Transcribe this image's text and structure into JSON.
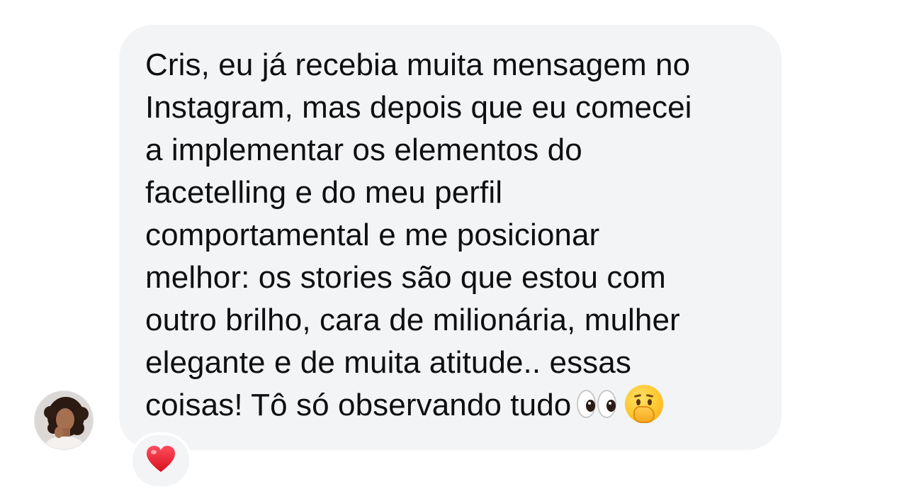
{
  "message": {
    "lines": [
      "Cris, eu já recebia muita mensagem no",
      "Instagram, mas depois que eu comecei",
      "a implementar os elementos do",
      "facetelling e do meu perfil",
      "comportamental e me posicionar",
      "melhor: os stories são que estou com",
      "outro brilho, cara de milionária, mulher",
      "elegante e de muita atitude.. essas",
      "coisas! Tô só observando tudo"
    ],
    "trailing_emojis": [
      "eyes-emoji",
      "face-with-hand-over-mouth-emoji"
    ]
  },
  "sender": {
    "avatar_icon": "profile-photo"
  },
  "reaction": {
    "icon": "red-heart-icon",
    "color": "#e3162b"
  },
  "colors": {
    "bubble_background": "#f3f4f6",
    "text": "#0f0f10",
    "page_background": "#ffffff"
  }
}
